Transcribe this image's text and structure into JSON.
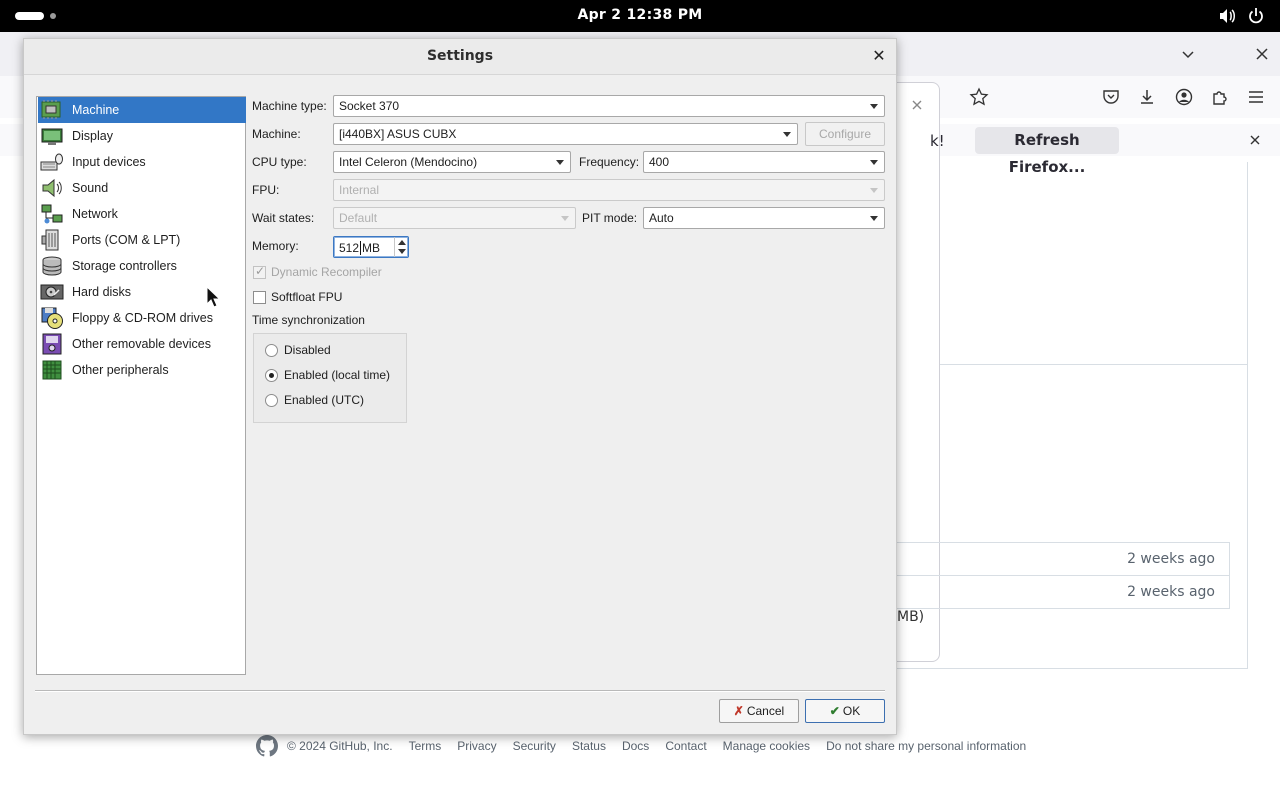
{
  "topbar": {
    "clock": "Apr 2  12:38 PM",
    "icons": [
      "activities-pill",
      "workspace-dot",
      "volume-icon",
      "power-icon"
    ]
  },
  "browser": {
    "notification_tail": "k!",
    "refresh_button": "Refresh Firefox...",
    "popup_tail": "MB)",
    "rows": [
      {
        "time": "2 weeks ago"
      },
      {
        "time": "2 weeks ago"
      }
    ]
  },
  "footer": {
    "copyright": "© 2024 GitHub, Inc.",
    "links": [
      "Terms",
      "Privacy",
      "Security",
      "Status",
      "Docs",
      "Contact",
      "Manage cookies",
      "Do not share my personal information"
    ]
  },
  "dialog": {
    "title": "Settings",
    "categories": [
      {
        "label": "Machine",
        "icon": "machine-icon",
        "selected": true
      },
      {
        "label": "Display",
        "icon": "display-icon"
      },
      {
        "label": "Input devices",
        "icon": "input-devices-icon"
      },
      {
        "label": "Sound",
        "icon": "sound-icon"
      },
      {
        "label": "Network",
        "icon": "network-icon"
      },
      {
        "label": "Ports (COM & LPT)",
        "icon": "ports-icon"
      },
      {
        "label": "Storage controllers",
        "icon": "storage-icon"
      },
      {
        "label": "Hard disks",
        "icon": "hard-disk-icon"
      },
      {
        "label": "Floppy & CD-ROM drives",
        "icon": "floppy-cdrom-icon"
      },
      {
        "label": "Other removable devices",
        "icon": "removable-icon"
      },
      {
        "label": "Other peripherals",
        "icon": "peripherals-icon"
      }
    ],
    "machine_type_label": "Machine type:",
    "machine_type_value": "Socket 370",
    "machine_label": "Machine:",
    "machine_value": "[i440BX] ASUS CUBX",
    "configure_label": "Configure",
    "cpu_type_label": "CPU type:",
    "cpu_type_value": "Intel Celeron (Mendocino)",
    "frequency_label": "Frequency:",
    "frequency_value": "400",
    "fpu_label": "FPU:",
    "fpu_value": "Internal",
    "wait_states_label": "Wait states:",
    "wait_states_value": "Default",
    "pit_mode_label": "PIT mode:",
    "pit_mode_value": "Auto",
    "memory_label": "Memory:",
    "memory_value": "512",
    "memory_unit": "MB",
    "dynamic_recompiler_label": "Dynamic Recompiler",
    "dynamic_recompiler_checked": true,
    "softfloat_label": "Softfloat FPU",
    "softfloat_checked": false,
    "time_sync_label": "Time synchronization",
    "time_sync_options": [
      {
        "label": "Disabled",
        "selected": false
      },
      {
        "label": "Enabled (local time)",
        "selected": true
      },
      {
        "label": "Enabled (UTC)",
        "selected": false
      }
    ],
    "cancel_label": "Cancel",
    "ok_label": "OK"
  }
}
